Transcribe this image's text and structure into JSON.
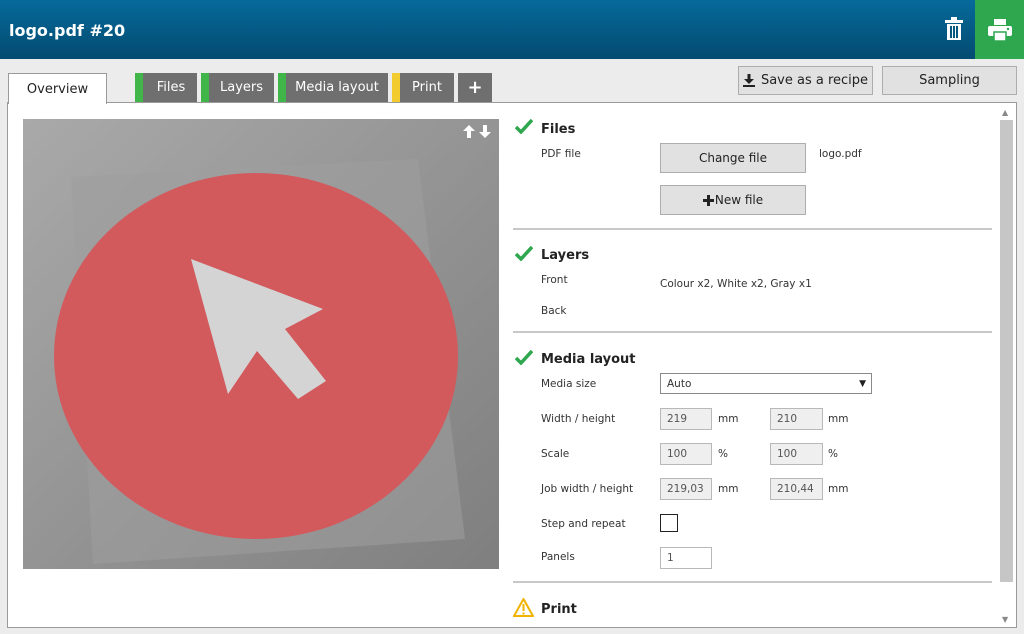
{
  "header": {
    "title": "logo.pdf #20"
  },
  "icons": {
    "trash": "trash-icon",
    "print": "printer-icon",
    "check": "check-icon",
    "warning": "warning-icon",
    "download": "download-icon",
    "up": "arrow-up-icon",
    "down": "arrow-down-icon",
    "plus": "plus-icon"
  },
  "colors": {
    "header_top": "#066a9a",
    "header_bottom": "#034b71",
    "print_green": "#2fa74f",
    "tab_green": "#3fb54a",
    "tab_yellow": "#f2cc2e",
    "check_green": "#2fa74f",
    "disc_red": "#d25a5d"
  },
  "tabs": [
    {
      "label": "Overview",
      "active": true
    },
    {
      "label": "Files",
      "status": "green"
    },
    {
      "label": "Layers",
      "status": "green"
    },
    {
      "label": "Media layout",
      "status": "green"
    },
    {
      "label": "Print",
      "status": "yellow"
    },
    {
      "label": "+"
    }
  ],
  "actions": {
    "save_recipe": "Save as a recipe",
    "sampling": "Sampling"
  },
  "files": {
    "title": "Files",
    "pdf_label": "PDF file",
    "change_button": "Change file",
    "filename": "logo.pdf",
    "new_button": "New file"
  },
  "layers": {
    "title": "Layers",
    "front_label": "Front",
    "front_value": "Colour x2, White x2, Gray x1",
    "back_label": "Back"
  },
  "media": {
    "title": "Media layout",
    "media_size_label": "Media size",
    "media_size_value": "Auto",
    "wh_label": "Width / height",
    "width": "219",
    "height": "210",
    "unit_mm": "mm",
    "scale_label": "Scale",
    "scale_x": "100",
    "scale_y": "100",
    "unit_pct": "%",
    "job_wh_label": "Job width / height",
    "job_width": "219,03",
    "job_height": "210,44",
    "step_repeat_label": "Step and repeat",
    "panels_label": "Panels",
    "panels_value": "1"
  },
  "print": {
    "title": "Print"
  }
}
